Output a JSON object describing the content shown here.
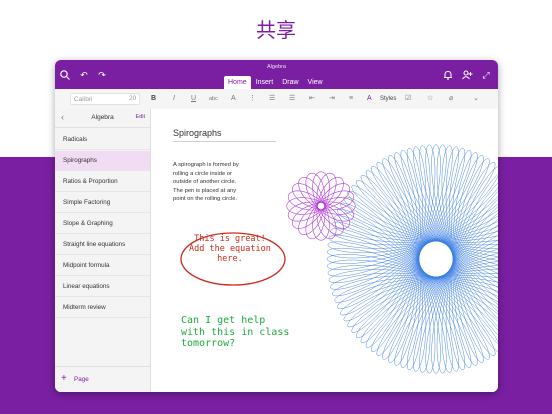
{
  "headline": "共享",
  "colors": {
    "brand": "#7a1fa2",
    "accent_text": "#7a1fa2",
    "hw_red": "#cc2a1a",
    "hw_green": "#1da93d",
    "spiro_blue": "#3b7de3",
    "spiro_purple": "#b23bd6"
  },
  "window": {
    "doc_title": "Algebra",
    "tabs": [
      {
        "label": "Home",
        "active": true
      },
      {
        "label": "Insert"
      },
      {
        "label": "Draw"
      },
      {
        "label": "View"
      }
    ],
    "icons": {
      "search": "search-icon",
      "undo": "undo-icon",
      "redo": "redo-icon",
      "bell": "bell-icon",
      "share": "share-user-icon",
      "expand": "expand-icon"
    }
  },
  "ribbon": {
    "font_name": "Calibri",
    "font_size": "20",
    "bold": "B",
    "italic": "I",
    "underline": "U",
    "strike": "abc",
    "font_color": "A",
    "styles_label": "Styles"
  },
  "sidebar": {
    "back": "‹",
    "title": "Algebra",
    "edit": "Edit",
    "items": [
      {
        "label": "Radicals"
      },
      {
        "label": "Spirographs",
        "selected": true
      },
      {
        "label": "Ratios & Proportion"
      },
      {
        "label": "Simple Factoring"
      },
      {
        "label": "Slope & Graphing"
      },
      {
        "label": "Straight line equations"
      },
      {
        "label": "Midpoint formula"
      },
      {
        "label": "Linear equations"
      },
      {
        "label": "Midterm review"
      }
    ],
    "add_page_icon": "+",
    "add_page_label": "Page"
  },
  "page": {
    "title": "Spirographs",
    "body": "A spirograph is formed by\nrolling a circle inside or\noutside of another circle.\nThe pen is placed at any\npoint on the rolling circle.",
    "handwriting_red": "This is great!\nAdd the equation\nhere.",
    "handwriting_green": "Can I get help\nwith this in class\ntomorrow?"
  }
}
